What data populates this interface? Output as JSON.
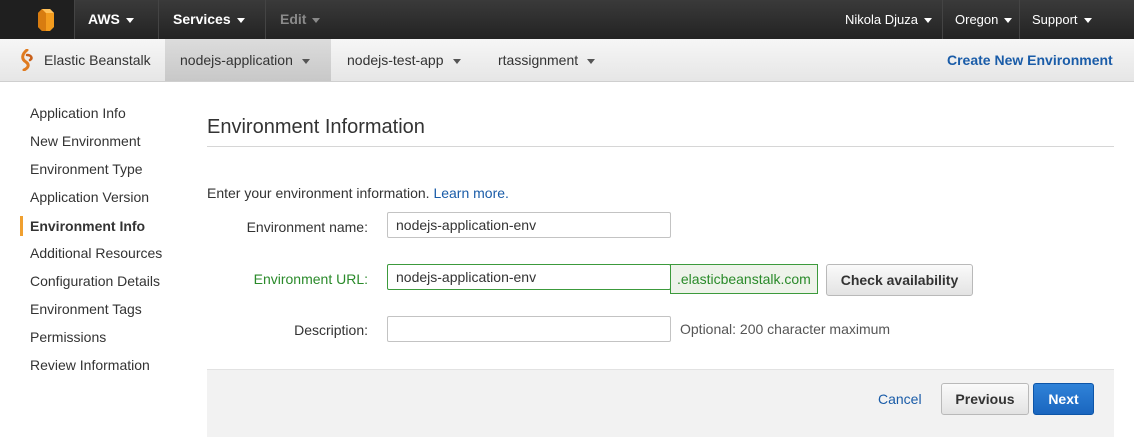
{
  "topbar": {
    "brand": "AWS",
    "services": "Services",
    "edit": "Edit",
    "user": "Nikola Djuza",
    "region": "Oregon",
    "support": "Support"
  },
  "appbar": {
    "service_name": "Elastic Beanstalk",
    "apps": [
      "nodejs-application",
      "nodejs-test-app",
      "rtassignment"
    ],
    "create_label": "Create New Environment"
  },
  "sidebar": {
    "items": [
      "Application Info",
      "New Environment",
      "Environment Type",
      "Application Version",
      "Environment Info",
      "Additional Resources",
      "Configuration Details",
      "Environment Tags",
      "Permissions",
      "Review Information"
    ],
    "active_index": 4
  },
  "main": {
    "heading": "Environment Information",
    "intro_text": "Enter your environment information.",
    "learn_more": "Learn more.",
    "name_label": "Environment name:",
    "name_value": "nodejs-application-env",
    "url_label": "Environment URL:",
    "url_value": "nodejs-application-env",
    "url_suffix": ".elasticbeanstalk.com",
    "check_label": "Check availability",
    "desc_label": "Description:",
    "desc_value": "",
    "desc_hint": "Optional: 200 character maximum"
  },
  "footer": {
    "cancel": "Cancel",
    "previous": "Previous",
    "next": "Next"
  },
  "colors": {
    "accent": "#1a5ca8",
    "valid_green": "#2a8a2a",
    "nav_marker": "#f0a030"
  }
}
